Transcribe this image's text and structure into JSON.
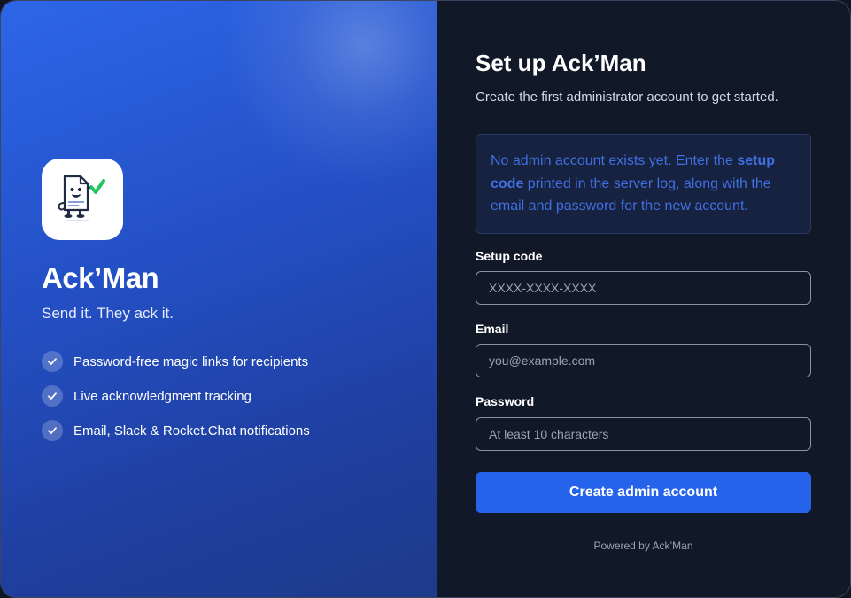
{
  "brand": {
    "name": "Ack’Man",
    "tagline": "Send it. They ack it.",
    "logo_icon": "mascot-document-check-icon",
    "features": [
      {
        "label": "Password-free magic links for recipients",
        "icon": "check-icon"
      },
      {
        "label": "Live acknowledgment tracking",
        "icon": "check-icon"
      },
      {
        "label": "Email, Slack & Rocket.Chat notifications",
        "icon": "check-icon"
      }
    ]
  },
  "form": {
    "title": "Set up Ack’Man",
    "subtitle": "Create the first administrator account to get started.",
    "notice": {
      "prefix": "No admin account exists yet. Enter the ",
      "emphasis": "setup code",
      "suffix": " printed in the server log, along with the email and password for the new account."
    },
    "fields": {
      "setup_code": {
        "label": "Setup code",
        "placeholder": "XXXX-XXXX-XXXX",
        "value": ""
      },
      "email": {
        "label": "Email",
        "placeholder": "you@example.com",
        "value": ""
      },
      "password": {
        "label": "Password",
        "placeholder": "At least 10 characters",
        "value": ""
      }
    },
    "submit_label": "Create admin account",
    "footer": "Powered by Ack’Man"
  },
  "colors": {
    "accent": "#2563eb",
    "panel_gradient_start": "#2d66e8",
    "panel_gradient_end": "#1e3a8a",
    "notice_text": "#3f6fe0",
    "background": "#111827"
  }
}
